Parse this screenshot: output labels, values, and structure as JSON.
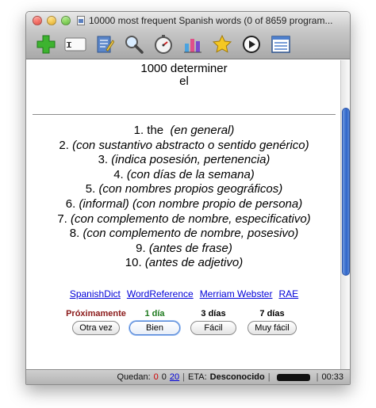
{
  "window": {
    "title": "10000 most frequent Spanish words (0 of 8659 program..."
  },
  "toolbar": {
    "icons": [
      "add-icon",
      "card-icon",
      "edit-icon",
      "search-icon",
      "timer-icon",
      "stats-icon",
      "star-icon",
      "play-icon",
      "list-icon"
    ]
  },
  "card": {
    "rank_pos": "1000 determiner",
    "word": "el",
    "meanings": [
      {
        "num": "1.",
        "main": "the",
        "note": "(en general)"
      },
      {
        "num": "2.",
        "main": "",
        "note": "(con sustantivo abstracto o sentido genérico)"
      },
      {
        "num": "3.",
        "main": "",
        "note": "(indica posesión, pertenencia)"
      },
      {
        "num": "4.",
        "main": "",
        "note": "(con días de la semana)"
      },
      {
        "num": "5.",
        "main": "",
        "note": "(con nombres propios geográficos)"
      },
      {
        "num": "6.",
        "main": "",
        "note": "(informal) (con nombre propio de persona)"
      },
      {
        "num": "7.",
        "main": "",
        "note": "(con complemento de nombre, especificativo)"
      },
      {
        "num": "8.",
        "main": "",
        "note": "(con complemento de nombre, posesivo)"
      },
      {
        "num": "9.",
        "main": "",
        "note": "(antes de frase)"
      },
      {
        "num": "10.",
        "main": "",
        "note": "(antes de adjetivo)"
      }
    ]
  },
  "links": [
    "SpanishDict",
    "WordReference",
    "Merriam Webster",
    "RAE"
  ],
  "answers": [
    {
      "interval": "Próximamente",
      "color": "#8b1a1a",
      "button": "Otra vez"
    },
    {
      "interval": "1 día",
      "color": "#1e7a1e",
      "button": "Bien"
    },
    {
      "interval": "3 días",
      "color": "#000000",
      "button": "Fácil"
    },
    {
      "interval": "7 días",
      "color": "#000000",
      "button": "Muy fácil"
    }
  ],
  "status": {
    "quedan_label": "Quedan:",
    "count_red": "0",
    "count_black": "0",
    "count_link": "20",
    "eta_label": "ETA:",
    "eta_value": "Desconocido",
    "time": "00:33"
  },
  "colors": {
    "red_count": "#d00000",
    "link": "#0000d8"
  }
}
